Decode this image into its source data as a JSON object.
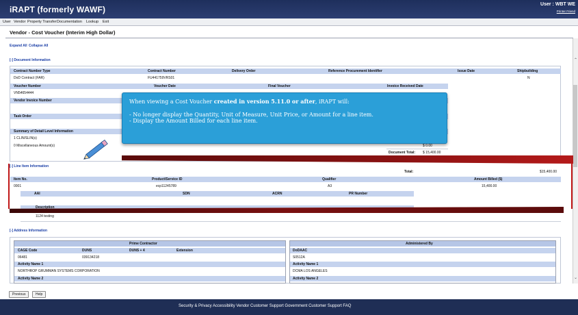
{
  "header": {
    "brand": "iRAPT (formerly WAWF)",
    "user": "User : WBT WE",
    "printer_friendly": "Printer Friend"
  },
  "menu": [
    "User",
    "Vendor",
    "Property Transfer",
    "Documentation",
    "Lookup",
    "Exit"
  ],
  "page_title": "Vendor - Cost Voucher (Interim High Dollar)",
  "links": {
    "expand": "Expand All",
    "collapse": "Collapse All"
  },
  "doc": {
    "section": "[-] Document Information",
    "h1": [
      "Contract Number Type",
      "Contract Number",
      "Delivery Order",
      "Reference Procurement Identifier",
      "Issue Date",
      "Shipbuilding"
    ],
    "r1": [
      "DoD Contract (FAR)",
      "FU441759VRS01",
      "N"
    ],
    "h2": [
      "Voucher Number",
      "Voucher Date",
      "Final Voucher",
      "Invoice Received Date"
    ],
    "voucher_number": "VN54654444",
    "vendor_invoice": "Vendor Invoice Number",
    "task_order": "Task Order",
    "summary": "Summary of Detail Level Information",
    "clin": "1 CLIN/SLIN(s)",
    "misc": "0 Miscellaneous Amount(s)",
    "misc_amt": "$ 0.00",
    "doc_total_label": "Document Total:",
    "doc_total": "$ 15,400.00"
  },
  "line": {
    "section": "[-] Line Item Information",
    "total_label": "Total:",
    "total": "$15,400.00",
    "h1": [
      "Item No.",
      "Product/Service ID",
      "Qualifier",
      "Amount Billed ($)"
    ],
    "r1": [
      "0001",
      "ecp11245789",
      "A3",
      "15,400.00"
    ],
    "h2": [
      "AAI",
      "SDN",
      "ACRN",
      "PR Number"
    ],
    "description_label": "Description",
    "description": "1124 testing"
  },
  "address": {
    "section": "[-] Address Information",
    "prime_title": "Prime Contractor",
    "admin_title": "Administered By",
    "prime_h": [
      "CAGE Code",
      "DUNS",
      "DUNS + 4",
      "Extension"
    ],
    "prime_v": [
      "06481",
      "039134218"
    ],
    "activity1": "Activity Name 1",
    "prime_act1": "NORTHROP GRUMMAN SYSTEMS CORPORATION",
    "activity2": "Activity Name 2",
    "admin_h": "DoDAAC",
    "admin_v": "S0512A",
    "admin_act1": "DCMA LOS ANGELES"
  },
  "buttons": {
    "previous": "Previous",
    "help": "Help"
  },
  "footer": "Security & Privacy   Accessibility   Vendor Customer Support   Government Customer Support   FAQ",
  "callout": {
    "intro_a": "When viewing a Cost Voucher ",
    "intro_b": "created in version 5.11.0 or after",
    "intro_c": ", iRAPT will:",
    "bullet1": "- No longer display the Quantity, Unit of Measure, Unit Price, or Amount for a line item.",
    "bullet2": "- Display the Amount Billed for each line item."
  }
}
